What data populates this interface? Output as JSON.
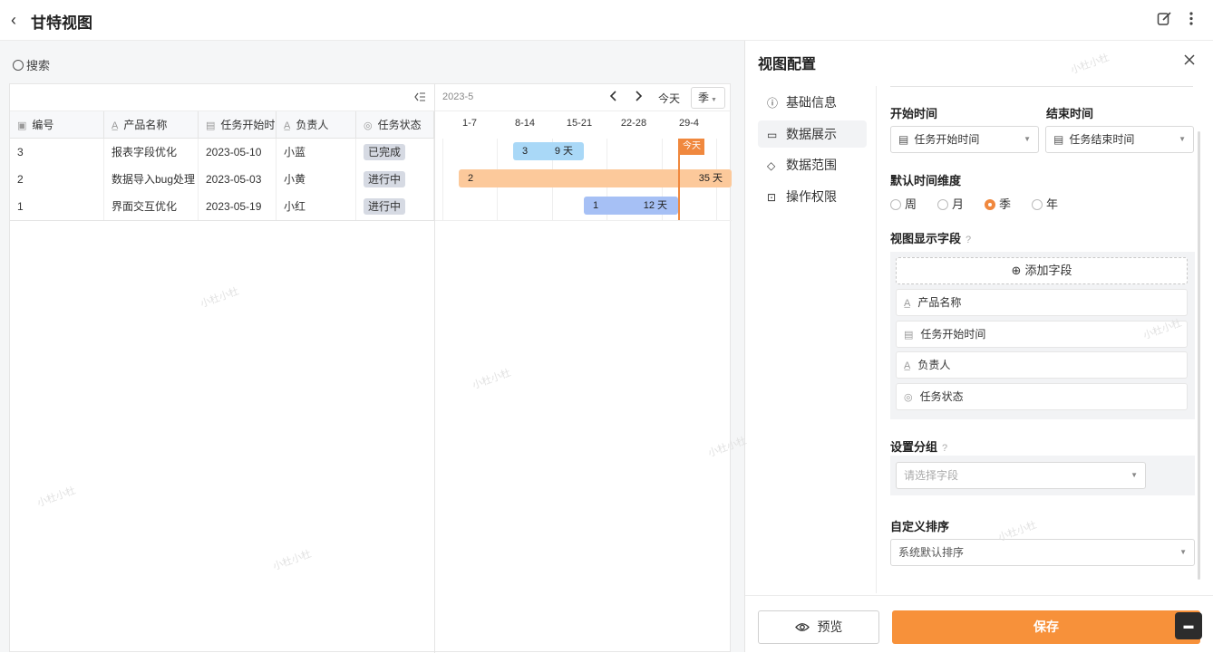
{
  "header": {
    "back_glyph": "‹",
    "title": "甘特视图",
    "edit_icon": "edit-icon",
    "more_icon": "more-icon"
  },
  "search": {
    "label": "搜索"
  },
  "table": {
    "columns": [
      "编号",
      "产品名称",
      "任务开始时间",
      "负责人",
      "任务状态"
    ],
    "rows": [
      {
        "id": "3",
        "name": "报表字段优化",
        "start": "2023-05-10",
        "owner": "小蓝",
        "status": "已完成"
      },
      {
        "id": "2",
        "name": "数据导入bug处理",
        "start": "2023-05-03",
        "owner": "小黄",
        "status": "进行中"
      },
      {
        "id": "1",
        "name": "界面交互优化",
        "start": "2023-05-19",
        "owner": "小红",
        "status": "进行中"
      }
    ]
  },
  "gantt": {
    "month": "2023-5",
    "today_btn": "今天",
    "scale_select": "季",
    "weeks": [
      "1-7",
      "8-14",
      "15-21",
      "22-28",
      "29-4"
    ],
    "today_badge": "今天",
    "bars": [
      {
        "id": "3",
        "days": "9 天",
        "color": "#a9d8f7"
      },
      {
        "id": "2",
        "days": "35 天",
        "color": "#fcc99b"
      },
      {
        "id": "1",
        "days": "12 天",
        "color": "#a6c0f5"
      }
    ]
  },
  "panel": {
    "title": "视图配置",
    "nav": [
      "基础信息",
      "数据展示",
      "数据范围",
      "操作权限"
    ],
    "start_label": "开始时间",
    "end_label": "结束时间",
    "start_value": "任务开始时间",
    "end_value": "结束时间_placeholder",
    "end_value_text": "任务结束时间",
    "dim_label": "默认时间维度",
    "dims": [
      "周",
      "月",
      "季",
      "年"
    ],
    "dim_selected": "季",
    "fields_label": "视图显示字段",
    "add_field": "添加字段",
    "fields": [
      "产品名称",
      "任务开始时间",
      "负责人",
      "任务状态"
    ],
    "group_label": "设置分组",
    "group_placeholder": "请选择字段",
    "sort_label": "自定义排序",
    "sort_value": "系统默认排序",
    "preview_btn": "预览",
    "save_btn": "保存"
  },
  "watermark": "小杜小杜",
  "colors": {
    "accent": "#f7913a",
    "today": "#f0883e"
  }
}
